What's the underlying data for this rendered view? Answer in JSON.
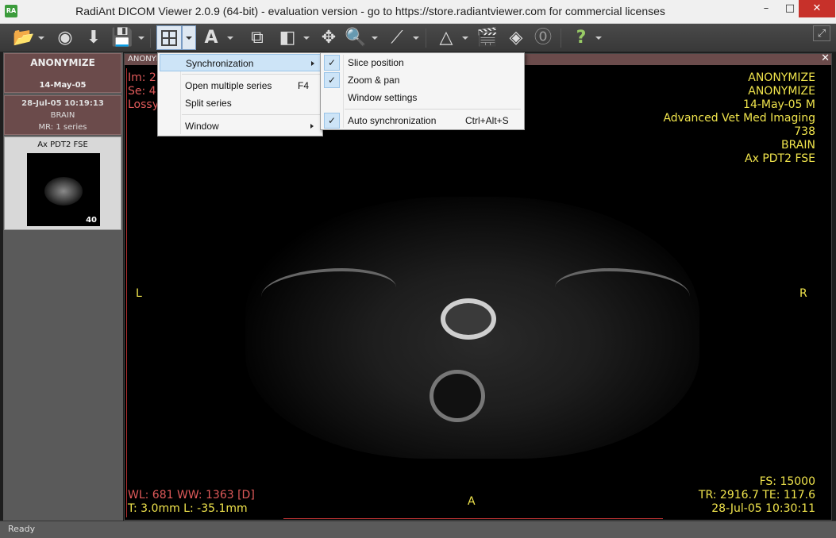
{
  "window": {
    "title": "RadiAnt DICOM Viewer 2.0.9 (64-bit) - evaluation version - go to https://store.radiantviewer.com for commercial licenses",
    "app_icon_text": "RA",
    "minimize": "–",
    "maximize": "□",
    "close": "✕"
  },
  "toolbar": {
    "open_icon": "📂",
    "cd_icon": "◉",
    "download_icon": "⬇",
    "save_icon": "💾",
    "layout_icon": "layout-grid-icon",
    "text_icon": "A",
    "series_icon": "⧉",
    "window_level_icon": "◧",
    "pan_icon": "✥",
    "zoom_icon": "🔍",
    "measure_icon": "⟋",
    "mpr_icon": "△",
    "cine_icon": "🎬",
    "mr_icon": "◈",
    "fusion_icon": "⓪",
    "help_icon": "?",
    "fullscreen_icon": "⤢"
  },
  "sidebar": {
    "patient_name": "ANONYMIZE",
    "patient_date": "14-May-05",
    "study_datetime": "28-Jul-05 10:19:13",
    "study_desc": "BRAIN",
    "study_series": "MR: 1 series",
    "series_title": "Ax PDT2 FSE",
    "series_count": "40"
  },
  "viewport": {
    "header": "ANONYMIZE",
    "close": "✕",
    "top_left": [
      "Im: 2",
      "Se: 4",
      "Lossy"
    ],
    "top_right": [
      "ANONYMIZE",
      "ANONYMIZE",
      "14-May-05 M",
      "Advanced Vet Med Imaging",
      "738",
      "BRAIN",
      "Ax PDT2 FSE"
    ],
    "left_marker": "L",
    "right_marker": "R",
    "bottom_marker": "A",
    "bottom_left": [
      "WL: 681 WW: 1363 [D]",
      "T: 3.0mm L: -35.1mm"
    ],
    "bottom_right": [
      "FS: 15000",
      "TR: 2916.7 TE: 117.6",
      "28-Jul-05 10:30:11"
    ]
  },
  "menu": {
    "synchronization": "Synchronization",
    "open_multiple_series": "Open multiple series",
    "open_multiple_shortcut": "F4",
    "split_series": "Split series",
    "window": "Window"
  },
  "submenu": {
    "slice_position": "Slice position",
    "zoom_pan": "Zoom & pan",
    "window_settings": "Window settings",
    "auto_sync": "Auto synchronization",
    "auto_sync_shortcut": "Ctrl+Alt+S",
    "check": "✓"
  },
  "status": {
    "text": "Ready"
  },
  "colors": {
    "overlay_yellow": "#f0e44c",
    "overlay_red": "#e05a5a",
    "menu_highlight": "#cde4f7"
  }
}
